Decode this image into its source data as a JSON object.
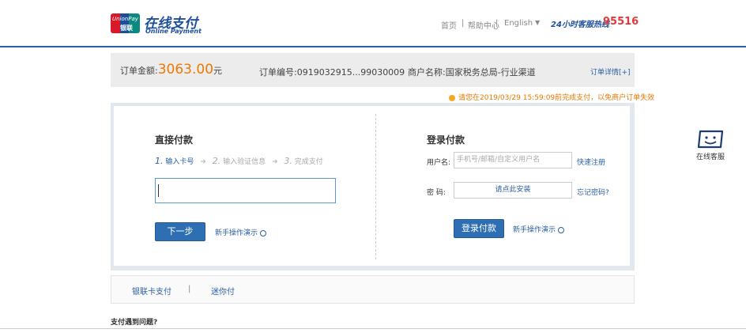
{
  "header": {
    "logo_badge_text_en": "UnionPay",
    "logo_badge_text_cn": "银联",
    "logo_cn": "在线支付",
    "logo_en": "Online Payment",
    "nav": {
      "home": "首页",
      "sep1": "|",
      "help": "帮助中心",
      "sep2": "|",
      "language": "English",
      "hotline_label": "24小时客服热线",
      "hotline_number": "95516"
    }
  },
  "order": {
    "amount_label": "订单金额:",
    "amount_value": "3063.00",
    "amount_unit": "元",
    "number_label": "订单编号:",
    "number_value": "0919032915...99030009",
    "merchant_label": "商户名称:",
    "merchant_value": "国家税务总局-行业渠道",
    "details_link": "订单详情[+]"
  },
  "notice": "请您在2019/03/29 15:59:09前完成支付，以免商户订单失效",
  "direct_pay": {
    "title": "直接付款",
    "steps": [
      {
        "num": "1.",
        "label": "输入卡号"
      },
      {
        "num": "2.",
        "label": "输入验证信息"
      },
      {
        "num": "3.",
        "label": "完成支付"
      }
    ],
    "card_input_value": "",
    "next_button": "下一步",
    "guide_link": "新手操作演示"
  },
  "login_pay": {
    "title": "登录付款",
    "username_label": "用户名:",
    "username_placeholder": "手机号/邮箱/自定义用户名",
    "register_link": "快速注册",
    "password_label": "密  码:",
    "password_placeholder": "请点此安装",
    "forgot_link": "忘记密码?",
    "login_button": "登录付款",
    "guide_link": "新手操作演示"
  },
  "tabs": [
    {
      "label": "银联卡支付"
    },
    {
      "label": "|"
    },
    {
      "label": "迷你付"
    }
  ],
  "help_text": "支付遇到问题?",
  "customer_service": {
    "label": "在线客服",
    "icon": "chat-face-icon"
  },
  "colors": {
    "brand_blue": "#2b5fa3",
    "amount_orange": "#f07800",
    "hotline_red": "#e4393c"
  }
}
